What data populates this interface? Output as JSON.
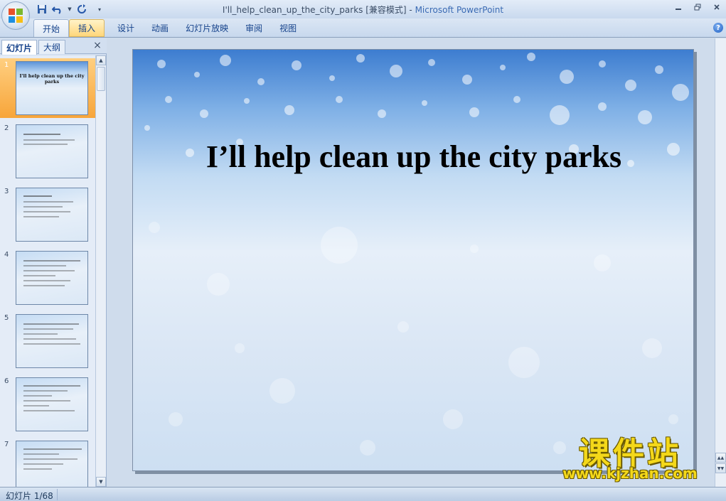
{
  "window": {
    "title_doc": "I'll_help_clean_up_the_city_parks [兼容模式]",
    "title_sep": " - ",
    "title_app": "Microsoft PowerPoint"
  },
  "ribbon": {
    "tabs": [
      {
        "label": "开始"
      },
      {
        "label": "插入"
      },
      {
        "label": "设计"
      },
      {
        "label": "动画"
      },
      {
        "label": "幻灯片放映"
      },
      {
        "label": "审阅"
      },
      {
        "label": "视图"
      }
    ],
    "help_label": "?"
  },
  "panel": {
    "tab_slides": "幻灯片",
    "tab_outline": "大纲",
    "close_label": "×",
    "thumbnails": [
      {
        "num": "1",
        "title": "I'll help clean up the city parks"
      },
      {
        "num": "2"
      },
      {
        "num": "3"
      },
      {
        "num": "4"
      },
      {
        "num": "5"
      },
      {
        "num": "6"
      },
      {
        "num": "7"
      }
    ]
  },
  "slide": {
    "title": "I’ll help clean up the city parks"
  },
  "watermark": {
    "text_cn": "课件站",
    "url": "www.kjzhan.com"
  },
  "status": {
    "slide_indicator": "幻灯片 1/68"
  },
  "colors": {
    "ribbon_text": "#15428b",
    "selected_thumb": "#f7a53a",
    "watermark": "#f4d81a"
  }
}
